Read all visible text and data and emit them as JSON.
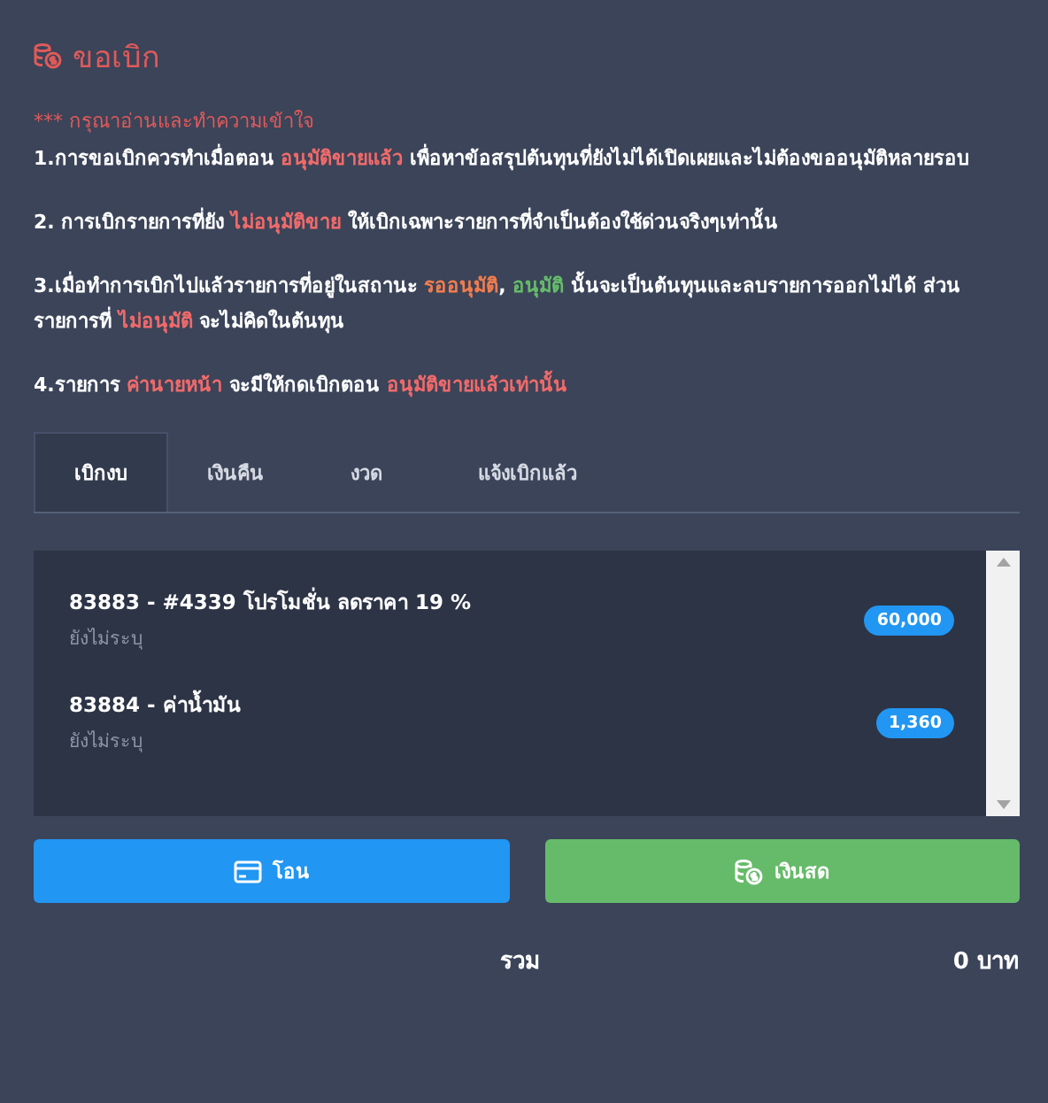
{
  "title": "ขอเบิก",
  "warning": "*** กรุณาอ่านและทำความเข้าใจ",
  "notes": [
    {
      "segments": [
        {
          "text": "1.การขอเบิกควรทำเมื่อตอน "
        },
        {
          "text": "อนุมัติขายแล้ว",
          "color": "#f06a6a"
        },
        {
          "text": " เพื่อหาข้อสรุปต้นทุนที่ยังไม่ได้เปิดเผยและไม่ต้องขออนุมัติหลายรอบ"
        }
      ]
    },
    {
      "segments": [
        {
          "text": "2. การเบิกรายการที่ยัง "
        },
        {
          "text": "ไม่อนุมัติขาย",
          "color": "#f06a6a"
        },
        {
          "text": " ให้เบิกเฉพาะรายการที่จำเป็นต้องใช้ด่วนจริงๆเท่านั้น"
        }
      ]
    },
    {
      "segments": [
        {
          "text": "3.เมื่อทำการเบิกไปแล้วรายการที่อยู่ในสถานะ "
        },
        {
          "text": "รออนุมัติ",
          "color": "#f27d4e"
        },
        {
          "text": ", "
        },
        {
          "text": "อนุมัติ",
          "color": "#66bb6a"
        },
        {
          "text": " นั้นจะเป็นต้นทุนและลบรายการออกไม่ได้ ส่วนรายการที่ "
        },
        {
          "text": "ไม่อนุมัติ",
          "color": "#f06a6a"
        },
        {
          "text": " จะไม่คิดในต้นทุน"
        }
      ]
    },
    {
      "segments": [
        {
          "text": "4.รายการ "
        },
        {
          "text": "ค่านายหน้า",
          "color": "#f06a6a"
        },
        {
          "text": " จะมีให้กดเบิกตอน "
        },
        {
          "text": "อนุมัติขายแล้วเท่านั้น",
          "color": "#f06a6a"
        }
      ]
    }
  ],
  "tabs": [
    {
      "label": "เบิกงบ",
      "selected": true
    },
    {
      "label": "เงินคืน",
      "selected": false
    },
    {
      "label": "งวด",
      "selected": false
    },
    {
      "label": "แจ้งเบิกแล้ว",
      "selected": false
    }
  ],
  "items": [
    {
      "title": "83883 - #4339 โปรโมชั่น ลดราคา 19 %",
      "subtitle": "ยังไม่ระบุ",
      "amount": "60,000"
    },
    {
      "title": "83884 - ค่าน้ำมัน",
      "subtitle": "ยังไม่ระบุ",
      "amount": "1,360"
    }
  ],
  "buttons": [
    {
      "kind": "transfer",
      "label": "โอน"
    },
    {
      "kind": "cash",
      "label": "เงินสด"
    }
  ],
  "total": {
    "label": "รวม",
    "value": "0 บาท"
  }
}
